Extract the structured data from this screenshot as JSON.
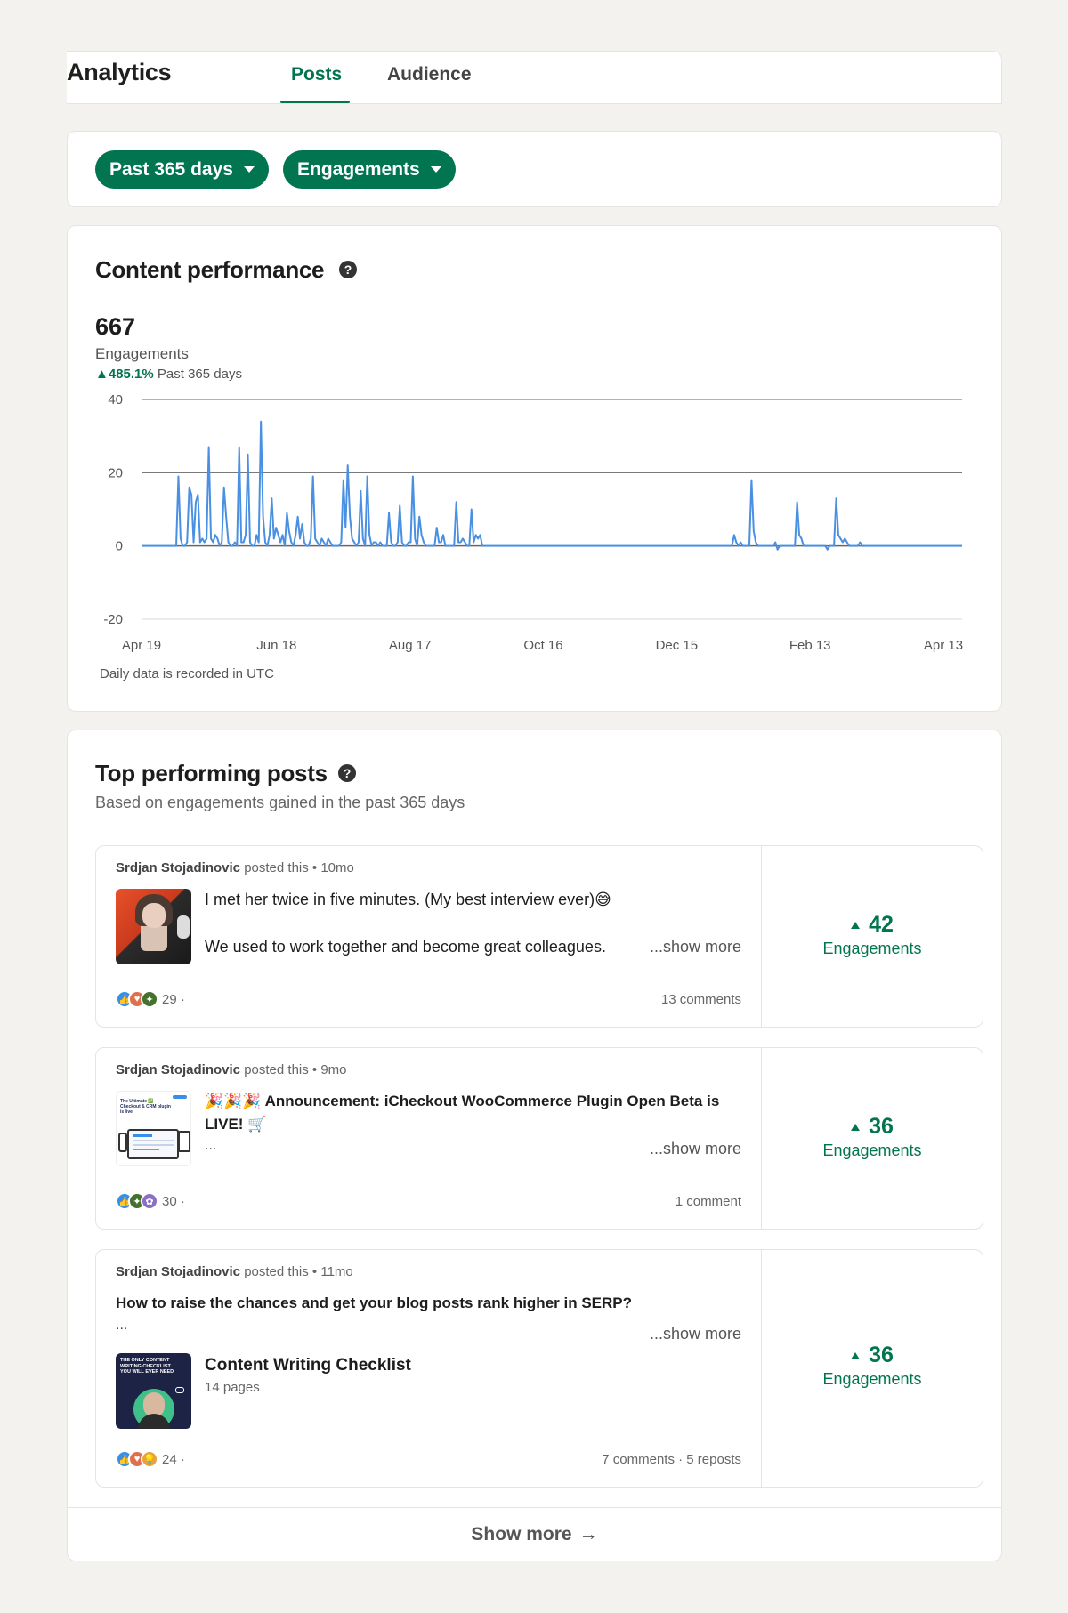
{
  "header": {
    "title": "Analytics",
    "tabs": [
      {
        "label": "Posts",
        "active": true
      },
      {
        "label": "Audience",
        "active": false
      }
    ]
  },
  "filters": {
    "range_label": "Past 365 days",
    "metric_label": "Engagements"
  },
  "performance": {
    "title": "Content performance",
    "help_icon": "question-circle-icon",
    "total": "667",
    "metric": "Engagements",
    "change": "485.1%",
    "change_period": "Past 365 days",
    "footnote": "Daily data is recorded in UTC"
  },
  "chart_data": {
    "type": "line",
    "ylim": [
      -20,
      40
    ],
    "yticks": [
      "40",
      "20",
      "0",
      "-20"
    ],
    "xtick_labels": [
      "Apr 19",
      "Jun 18",
      "Aug 17",
      "Oct 16",
      "Dec 15",
      "Feb 13",
      "Apr 13"
    ],
    "grid": true,
    "color": "#4a90e2",
    "series": [
      {
        "values": [
          0,
          0,
          0,
          0,
          0,
          0,
          0,
          0,
          0,
          0,
          0,
          0,
          0,
          0,
          0,
          0,
          0,
          0,
          0,
          0,
          0,
          0,
          0,
          0,
          0,
          0,
          0,
          0,
          0,
          0,
          0,
          0,
          0,
          0,
          0,
          0,
          0,
          0,
          0,
          0,
          0,
          0,
          0,
          0,
          0,
          0,
          0,
          0,
          0,
          0,
          0,
          0,
          0,
          0,
          0,
          0,
          0,
          0,
          0,
          0,
          0,
          0,
          0,
          0,
          0,
          0,
          0,
          0,
          0,
          0,
          0,
          0,
          0,
          0,
          0,
          0,
          0,
          0,
          0,
          0,
          0,
          0,
          0,
          0,
          0,
          0,
          0,
          0,
          0,
          0,
          0,
          0,
          0,
          0,
          0,
          0,
          0,
          0,
          0,
          0,
          0,
          0,
          0,
          0,
          0,
          0,
          0,
          0,
          0,
          0,
          0,
          0,
          0,
          0,
          0,
          0,
          0,
          0,
          0,
          0,
          0,
          0,
          0,
          0,
          0,
          0,
          0,
          0,
          0,
          0,
          0,
          0,
          0,
          0,
          0,
          0,
          0,
          0,
          0,
          0,
          0,
          0,
          0,
          0,
          0,
          0,
          0,
          0,
          0,
          0,
          0,
          0,
          0,
          0,
          0,
          0,
          0,
          0,
          0,
          0,
          0,
          0,
          0,
          0,
          0,
          0,
          0,
          0,
          0,
          0,
          0,
          0,
          0,
          0,
          0,
          0,
          0,
          0,
          0,
          0,
          0,
          0,
          0,
          0,
          0,
          0,
          0,
          0,
          0,
          0,
          0,
          0,
          0,
          0,
          0,
          0,
          0,
          0,
          0,
          0,
          0,
          0,
          0,
          0,
          0,
          0,
          0,
          0,
          0,
          0,
          0,
          0,
          0,
          0,
          0,
          0,
          0,
          0,
          0,
          0,
          0,
          0,
          0,
          0,
          0,
          0,
          0,
          0,
          0,
          0,
          0,
          0,
          0,
          0,
          0,
          0,
          0,
          0,
          0,
          0,
          0,
          0,
          0,
          0,
          0,
          0,
          0,
          0,
          0,
          0,
          0,
          0,
          0,
          0,
          0,
          0,
          0,
          0,
          0,
          0,
          0,
          0,
          0,
          0,
          0,
          0,
          0,
          0,
          0,
          0,
          0,
          0,
          0,
          0,
          0,
          0,
          0,
          0,
          0,
          0,
          0,
          0,
          0,
          0,
          0,
          0,
          0,
          0,
          0,
          0,
          0,
          0,
          0,
          0,
          0,
          0,
          0,
          0,
          0,
          0,
          0,
          0,
          0,
          0,
          0,
          0,
          0,
          0,
          0,
          0,
          0,
          0,
          0,
          0,
          0,
          0,
          0,
          0,
          0,
          0,
          0,
          0,
          0,
          0,
          0,
          0,
          0,
          0,
          0,
          0,
          0,
          0,
          0,
          0,
          0,
          0,
          0,
          0,
          0,
          0,
          0,
          0,
          0,
          0,
          0,
          0,
          0,
          0,
          0,
          0,
          0,
          0,
          0,
          0,
          0,
          0,
          0,
          0,
          0,
          0,
          0,
          0,
          0,
          0,
          0,
          0,
          0,
          0,
          0,
          0,
          0,
          0,
          0,
          0,
          0,
          0,
          0,
          0,
          0
        ]
      }
    ],
    "spikes": [
      [
        17,
        19
      ],
      [
        18,
        2
      ],
      [
        19,
        0
      ],
      [
        21,
        1
      ],
      [
        22,
        16
      ],
      [
        23,
        14
      ],
      [
        24,
        1
      ],
      [
        25,
        12
      ],
      [
        26,
        14
      ],
      [
        27,
        1
      ],
      [
        28,
        2
      ],
      [
        29,
        1
      ],
      [
        30,
        2
      ],
      [
        31,
        27
      ],
      [
        32,
        2
      ],
      [
        33,
        1
      ],
      [
        34,
        3
      ],
      [
        35,
        2
      ],
      [
        37,
        1
      ],
      [
        38,
        16
      ],
      [
        39,
        8
      ],
      [
        40,
        1
      ],
      [
        43,
        1
      ],
      [
        45,
        27
      ],
      [
        46,
        1
      ],
      [
        47,
        1
      ],
      [
        48,
        3
      ],
      [
        49,
        25
      ],
      [
        50,
        1
      ],
      [
        53,
        3
      ],
      [
        54,
        1
      ],
      [
        55,
        34
      ],
      [
        56,
        8
      ],
      [
        57,
        1
      ],
      [
        59,
        3
      ],
      [
        60,
        13
      ],
      [
        61,
        2
      ],
      [
        62,
        5
      ],
      [
        63,
        3
      ],
      [
        64,
        1
      ],
      [
        65,
        3
      ],
      [
        67,
        9
      ],
      [
        68,
        4
      ],
      [
        69,
        1
      ],
      [
        71,
        3
      ],
      [
        72,
        8
      ],
      [
        73,
        2
      ],
      [
        74,
        6
      ],
      [
        75,
        1
      ],
      [
        78,
        2
      ],
      [
        79,
        19
      ],
      [
        80,
        2
      ],
      [
        81,
        1
      ],
      [
        83,
        2
      ],
      [
        84,
        1
      ],
      [
        86,
        2
      ],
      [
        87,
        1
      ],
      [
        92,
        1
      ],
      [
        93,
        18
      ],
      [
        94,
        5
      ],
      [
        95,
        22
      ],
      [
        96,
        8
      ],
      [
        97,
        2
      ],
      [
        98,
        1
      ],
      [
        100,
        1
      ],
      [
        101,
        15
      ],
      [
        102,
        2
      ],
      [
        104,
        19
      ],
      [
        105,
        3
      ],
      [
        107,
        1
      ],
      [
        108,
        1
      ],
      [
        110,
        1
      ],
      [
        114,
        9
      ],
      [
        115,
        1
      ],
      [
        118,
        1
      ],
      [
        119,
        11
      ],
      [
        120,
        1
      ],
      [
        123,
        1
      ],
      [
        124,
        1
      ],
      [
        125,
        19
      ],
      [
        126,
        2
      ],
      [
        128,
        8
      ],
      [
        129,
        3
      ],
      [
        130,
        1
      ],
      [
        136,
        5
      ],
      [
        137,
        1
      ],
      [
        138,
        1
      ],
      [
        139,
        3
      ],
      [
        145,
        12
      ],
      [
        146,
        1
      ],
      [
        147,
        1
      ],
      [
        148,
        2
      ],
      [
        149,
        1
      ],
      [
        152,
        10
      ],
      [
        153,
        1
      ],
      [
        154,
        3
      ],
      [
        155,
        2
      ],
      [
        156,
        3
      ],
      [
        273,
        3
      ],
      [
        274,
        1
      ],
      [
        276,
        1
      ],
      [
        281,
        18
      ],
      [
        282,
        4
      ],
      [
        283,
        1
      ],
      [
        292,
        1
      ],
      [
        293,
        -1
      ],
      [
        302,
        12
      ],
      [
        303,
        3
      ],
      [
        304,
        2
      ],
      [
        316,
        -1
      ],
      [
        320,
        13
      ],
      [
        321,
        3
      ],
      [
        322,
        2
      ],
      [
        323,
        1
      ],
      [
        324,
        2
      ],
      [
        325,
        1
      ],
      [
        331,
        1
      ],
      [
        332,
        0
      ]
    ]
  },
  "top_posts": {
    "title": "Top performing posts",
    "subtitle": "Based on engagements gained in the past 365 days",
    "posted_this": "posted this",
    "show_more": "...show more",
    "engagements_label": "Engagements",
    "posts": [
      {
        "author": "Srdjan Stojadinovic",
        "age": "• 10mo",
        "line1": "I met her twice in five minutes. (My best interview ever)😅",
        "line2": "We used to work together and become great colleagues.",
        "reactions": "29 ·",
        "comments": "13 comments",
        "engagements": "42"
      },
      {
        "author": "Srdjan Stojadinovic",
        "age": "• 9mo",
        "line1": "🎉🎉🎉 Announcement: iCheckout WooCommerce Plugin Open Beta is",
        "line1b": "LIVE! 🛒",
        "line2": "...",
        "thumb_text": "The Ultimate ✅ Checkout & CRM plugin is live",
        "reactions": "30 ·",
        "comments": "1 comment",
        "engagements": "36"
      },
      {
        "author": "Srdjan Stojadinovic",
        "age": "• 11mo",
        "line1": "How to raise the chances and get your blog posts rank higher in SERP?",
        "line2": "...",
        "doc_title": "Content Writing Checklist",
        "doc_pages": "14 pages",
        "thumb_text": "THE ONLY CONTENT WRITING CHECKLIST YOU WILL EVER NEED",
        "reactions": "24 ·",
        "comments": "7 comments · 5 reposts",
        "engagements": "36"
      }
    ],
    "show_more_button": "Show more",
    "arrow_icon": "arrow-right-icon"
  }
}
